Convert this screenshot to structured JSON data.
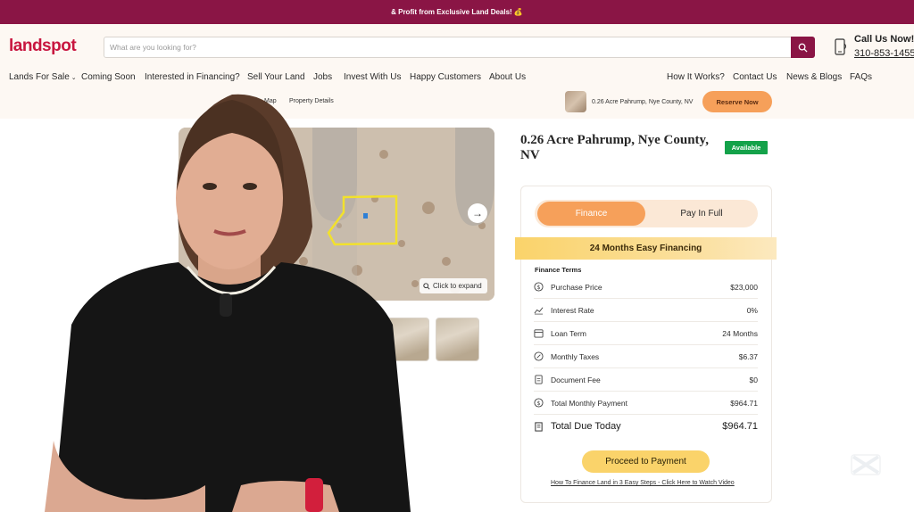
{
  "promo_bar": {
    "text": "& Profit from Exclusive Land Deals! 💰"
  },
  "header": {
    "logo": "landspot",
    "search_placeholder": "What are you looking for?",
    "call_label": "Call Us Now!",
    "call_number": "310-853-1455"
  },
  "nav": {
    "left": [
      "Lands For Sale",
      "Coming Soon",
      "Interested in Financing?",
      "Sell Your Land",
      "Jobs",
      "Invest With Us",
      "Happy Customers",
      "About Us"
    ],
    "right": [
      "How It Works?",
      "Contact Us",
      "News & Blogs",
      "FAQs"
    ]
  },
  "subnav": {
    "links": [
      "Map",
      "Property Details"
    ],
    "listing_title": "0.26 Acre Pahrump, Nye County, NV",
    "reserve_label": "Reserve Now"
  },
  "gallery": {
    "expand_label": "Click to expand"
  },
  "listing": {
    "title": "0.26 Acre Pahrump, Nye County, NV",
    "status": "Available"
  },
  "payment": {
    "tabs": [
      "Finance",
      "Pay In Full"
    ],
    "active_tab": "Finance",
    "banner": "24 Months Easy Financing",
    "terms_heading": "Finance Terms",
    "terms": [
      {
        "icon": "dollar-icon",
        "label": "Purchase Price",
        "value": "$23,000"
      },
      {
        "icon": "trend-icon",
        "label": "Interest Rate",
        "value": "0%"
      },
      {
        "icon": "calendar-icon",
        "label": "Loan Term",
        "value": "24 Months"
      },
      {
        "icon": "percent-icon",
        "label": "Monthly Taxes",
        "value": "$6.37"
      },
      {
        "icon": "document-icon",
        "label": "Document Fee",
        "value": "$0"
      },
      {
        "icon": "dollar-icon",
        "label": "Total Monthly Payment",
        "value": "$964.71"
      },
      {
        "icon": "receipt-icon",
        "label": "Total Due Today",
        "value": "$964.71"
      }
    ],
    "proceed_label": "Proceed to Payment",
    "video_link": "How To Finance Land in 3 Easy Steps - Click Here to Watch Video"
  },
  "colors": {
    "brand": "#8a1545",
    "logo": "#c8163f",
    "accent_orange": "#f6a05a",
    "accent_yellow": "#fad36a",
    "available_green": "#14a24a"
  }
}
